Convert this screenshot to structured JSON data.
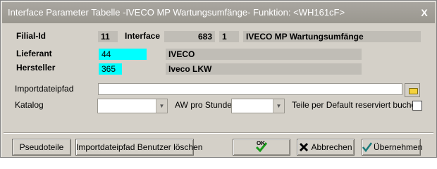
{
  "window": {
    "title": "Interface Parameter Tabelle -IVECO MP Wartungsumfänge- Funktion: <WH161cF>",
    "close_glyph": "X"
  },
  "header": {
    "filial_label": "Filial-Id",
    "filial_value": "11",
    "interface_label": "Interface",
    "interface_id": "683",
    "interface_num": "1",
    "interface_name": "IVECO MP Wartungsumfänge"
  },
  "lieferant": {
    "label": "Lieferant",
    "value": "44",
    "name": "IVECO"
  },
  "hersteller": {
    "label": "Hersteller",
    "value": "365",
    "name": "Iveco LKW"
  },
  "import": {
    "label": "Importdateipfad",
    "value": "",
    "folder_icon": "folder-icon"
  },
  "katalog": {
    "label": "Katalog",
    "value": ""
  },
  "aw": {
    "label": "AW pro Stunde",
    "value": ""
  },
  "teile": {
    "label": "Teile per Default reserviert buchen",
    "checked": false
  },
  "buttons": {
    "pseudoteile": "Pseudoteile",
    "delete_path": "Importdateipfad Benutzer löschen",
    "ok": "OK",
    "abbrechen": "Abbrechen",
    "uebernehmen": "Übernehmen"
  },
  "colors": {
    "highlight": "#00ffff",
    "window": "#d4d0c8"
  }
}
